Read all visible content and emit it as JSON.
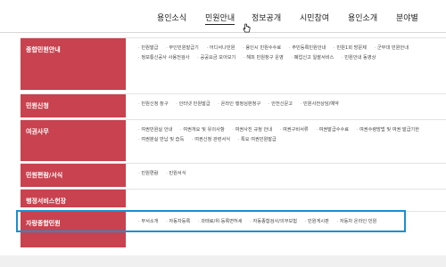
{
  "nav": {
    "items": [
      {
        "label": "용인소식"
      },
      {
        "label": "민원안내"
      },
      {
        "label": "정보공개"
      },
      {
        "label": "시민참여"
      },
      {
        "label": "용인소개"
      },
      {
        "label": "분야별"
      }
    ]
  },
  "sections": [
    {
      "title": "종합민원안내",
      "links": [
        "민원발급",
        "무인민원발급기",
        "어디서나민원",
        "용인시 민원수수료",
        "주민등록민원안내",
        "민원1회 방문제",
        "군부대 민원안내",
        "정보통신공사 사용전검사",
        "공공요금 모아보기",
        "해피 민원창구 운영",
        "폐업신고 일괄서비스",
        "민원안내 동영상"
      ]
    },
    {
      "title": "민원신청",
      "links": [
        "민원신청 창구",
        "인터넷 민원발급",
        "온라인 행정심판청구",
        "안전신문고",
        "민원사전상담/예약"
      ]
    },
    {
      "title": "여권사무",
      "links": [
        "여권민원실 안내",
        "여권개요 및 유의사항",
        "여권사진 규정 안내",
        "여권구비서류",
        "여권발급수수료",
        "여권수령방법 및 여권 발급기한",
        "여권분실 반납 및 습득",
        "여권신청 관련서식",
        "특요 여권민원발급"
      ]
    },
    {
      "title": "민원편람/서식",
      "links": [
        "민원편람",
        "민원서식"
      ]
    },
    {
      "title": "행정서비스헌장",
      "links": []
    },
    {
      "title": "자랑종합민원",
      "links": [
        "부서소개",
        "자동차등록",
        "과태료/위·등록면허세",
        "자동종합검사/의무보험",
        "민원게시판",
        "자동차 온라인 민원"
      ]
    }
  ],
  "colors": {
    "section_title_bg": "#c8424f",
    "highlight_border": "#1a8fd0"
  }
}
